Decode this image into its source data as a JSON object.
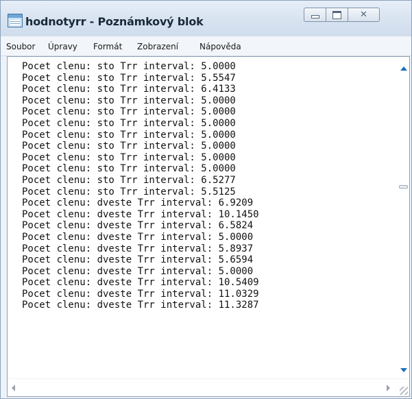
{
  "window": {
    "title": "hodnotyrr - Poznámkový blok",
    "icon": "notepad-icon",
    "buttons": {
      "minimize_icon": "minimize-icon",
      "maximize_icon": "maximize-icon",
      "close_icon": "close-icon",
      "close_glyph": "✕"
    }
  },
  "menu": {
    "items": [
      {
        "label": "Soubor"
      },
      {
        "label": "Úpravy"
      },
      {
        "label": "Formát"
      },
      {
        "label": "Zobrazení"
      },
      {
        "label": "Nápověda"
      }
    ]
  },
  "editor": {
    "lines": [
      "Pocet clenu: sto Trr interval: 5.0000",
      "Pocet clenu: sto Trr interval: 5.5547",
      "Pocet clenu: sto Trr interval: 6.4133",
      "Pocet clenu: sto Trr interval: 5.0000",
      "Pocet clenu: sto Trr interval: 5.0000",
      "Pocet clenu: sto Trr interval: 5.0000",
      "Pocet clenu: sto Trr interval: 5.0000",
      "Pocet clenu: sto Trr interval: 5.0000",
      "Pocet clenu: sto Trr interval: 5.0000",
      "Pocet clenu: sto Trr interval: 5.0000",
      "Pocet clenu: sto Trr interval: 6.5277",
      "Pocet clenu: sto Trr interval: 5.5125",
      "Pocet clenu: dveste Trr interval: 6.9209",
      "Pocet clenu: dveste Trr interval: 10.1450",
      "Pocet clenu: dveste Trr interval: 6.5824",
      "Pocet clenu: dveste Trr interval: 5.0000",
      "Pocet clenu: dveste Trr interval: 5.8937",
      "Pocet clenu: dveste Trr interval: 5.6594",
      "Pocet clenu: dveste Trr interval: 5.0000",
      "Pocet clenu: dveste Trr interval: 10.5409",
      "Pocet clenu: dveste Trr interval: 11.0329",
      "Pocet clenu: dveste Trr interval: 11.3287"
    ]
  },
  "scrollbars": {
    "vertical": {
      "up_icon": "scroll-up-arrow-icon",
      "down_icon": "scroll-down-arrow-icon"
    },
    "horizontal": {
      "left_icon": "scroll-left-arrow-icon",
      "right_icon": "scroll-right-arrow-icon"
    }
  },
  "colors": {
    "scroll_arrow_active": "#1c6fb5",
    "scroll_arrow_inactive": "#9aa3ad",
    "title_bar": "#d9e4f1"
  }
}
